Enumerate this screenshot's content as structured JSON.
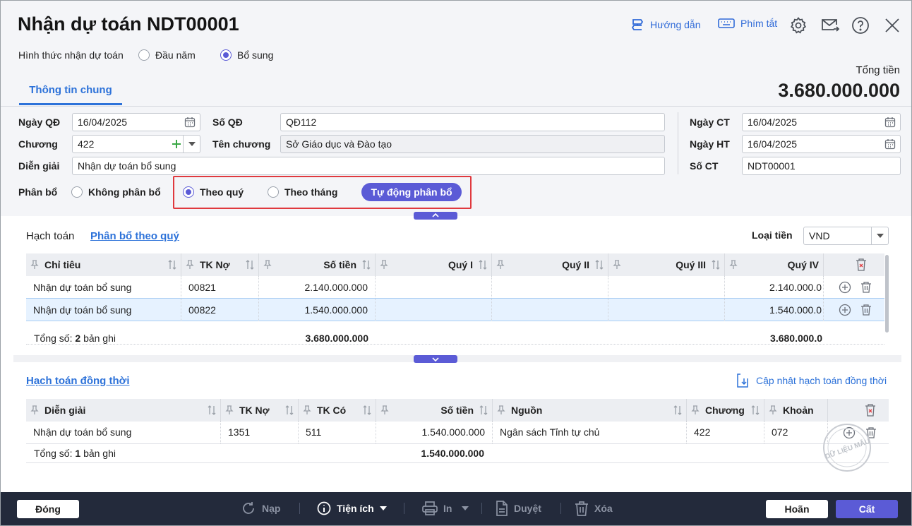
{
  "window": {
    "title": "Nhận dự toán NDT00001",
    "help_label": "Hướng dẫn",
    "shortcut_label": "Phím tắt"
  },
  "receive_type": {
    "label": "Hình thức nhận dự toán",
    "options": [
      "Đầu năm",
      "Bổ sung"
    ],
    "selected": "Bổ sung"
  },
  "tabs": [
    "Thông tin chung"
  ],
  "total": {
    "label": "Tổng tiền",
    "value": "3.680.000.000"
  },
  "form": {
    "ngay_qd": {
      "label": "Ngày QĐ",
      "value": "16/04/2025"
    },
    "so_qd": {
      "label": "Số QĐ",
      "value": "QĐ112"
    },
    "chuong": {
      "label": "Chương",
      "value": "422"
    },
    "ten_chuong": {
      "label": "Tên chương",
      "value": "Sở Giáo dục và Đào tạo"
    },
    "dien_giai": {
      "label": "Diễn giải",
      "value": "Nhận dự toán bổ sung"
    },
    "ngay_ct": {
      "label": "Ngày CT",
      "value": "16/04/2025"
    },
    "ngay_ht": {
      "label": "Ngày HT",
      "value": "16/04/2025"
    },
    "so_ct": {
      "label": "Số CT",
      "value": "NDT00001"
    }
  },
  "allocation": {
    "label": "Phân bổ",
    "options": [
      "Không phân bổ",
      "Theo quý",
      "Theo tháng"
    ],
    "selected": "Theo quý",
    "auto_button": "Tự động phân bổ"
  },
  "accounting": {
    "tabs": [
      "Hạch toán",
      "Phân bổ theo quý"
    ],
    "active_tab": "Phân bổ theo quý",
    "currency_label": "Loại tiền",
    "currency_value": "VND",
    "columns": [
      "Chỉ tiêu",
      "TK Nợ",
      "Số tiền",
      "Quý I",
      "Quý II",
      "Quý III",
      "Quý IV"
    ],
    "rows": [
      {
        "chi_tieu": "Nhận dự toán bổ sung",
        "tk_no": "00821",
        "so_tien": "2.140.000.000",
        "quy1": "",
        "quy2": "",
        "quy3": "",
        "quy4": "2.140.000.0"
      },
      {
        "chi_tieu": "Nhận dự toán bổ sung",
        "tk_no": "00822",
        "so_tien": "1.540.000.000",
        "quy1": "",
        "quy2": "",
        "quy3": "",
        "quy4": "1.540.000.0"
      }
    ],
    "footer": {
      "prefix": "Tổng số:",
      "count": "2",
      "suffix": "bản ghi",
      "so_tien": "3.680.000.000",
      "quy4": "3.680.000.0"
    }
  },
  "concurrent": {
    "title": "Hạch toán đồng thời",
    "update_label": "Cập nhật hạch toán đồng thời",
    "columns": [
      "Diễn giải",
      "TK Nợ",
      "TK Có",
      "Số tiền",
      "Nguồn",
      "Chương",
      "Khoản"
    ],
    "rows": [
      {
        "dien_giai": "Nhận dự toán bổ sung",
        "tk_no": "1351",
        "tk_co": "511",
        "so_tien": "1.540.000.000",
        "nguon": "Ngân sách Tỉnh tự chủ",
        "chuong": "422",
        "khoan": "072"
      }
    ],
    "footer": {
      "prefix": "Tổng số:",
      "count": "1",
      "suffix": "bản ghi",
      "so_tien": "1.540.000.000"
    },
    "watermark": "DỮ LIỆU MẪU"
  },
  "footer_bar": {
    "close": "Đóng",
    "reload": "Nạp",
    "utilities": "Tiện ích",
    "print": "In",
    "approve": "Duyệt",
    "delete": "Xóa",
    "undo": "Hoãn",
    "save": "Cất"
  },
  "colors": {
    "accent": "#5b5bd6",
    "link": "#2d72d9",
    "footer_bg": "#232a3b",
    "highlight_border": "#e0393e"
  }
}
